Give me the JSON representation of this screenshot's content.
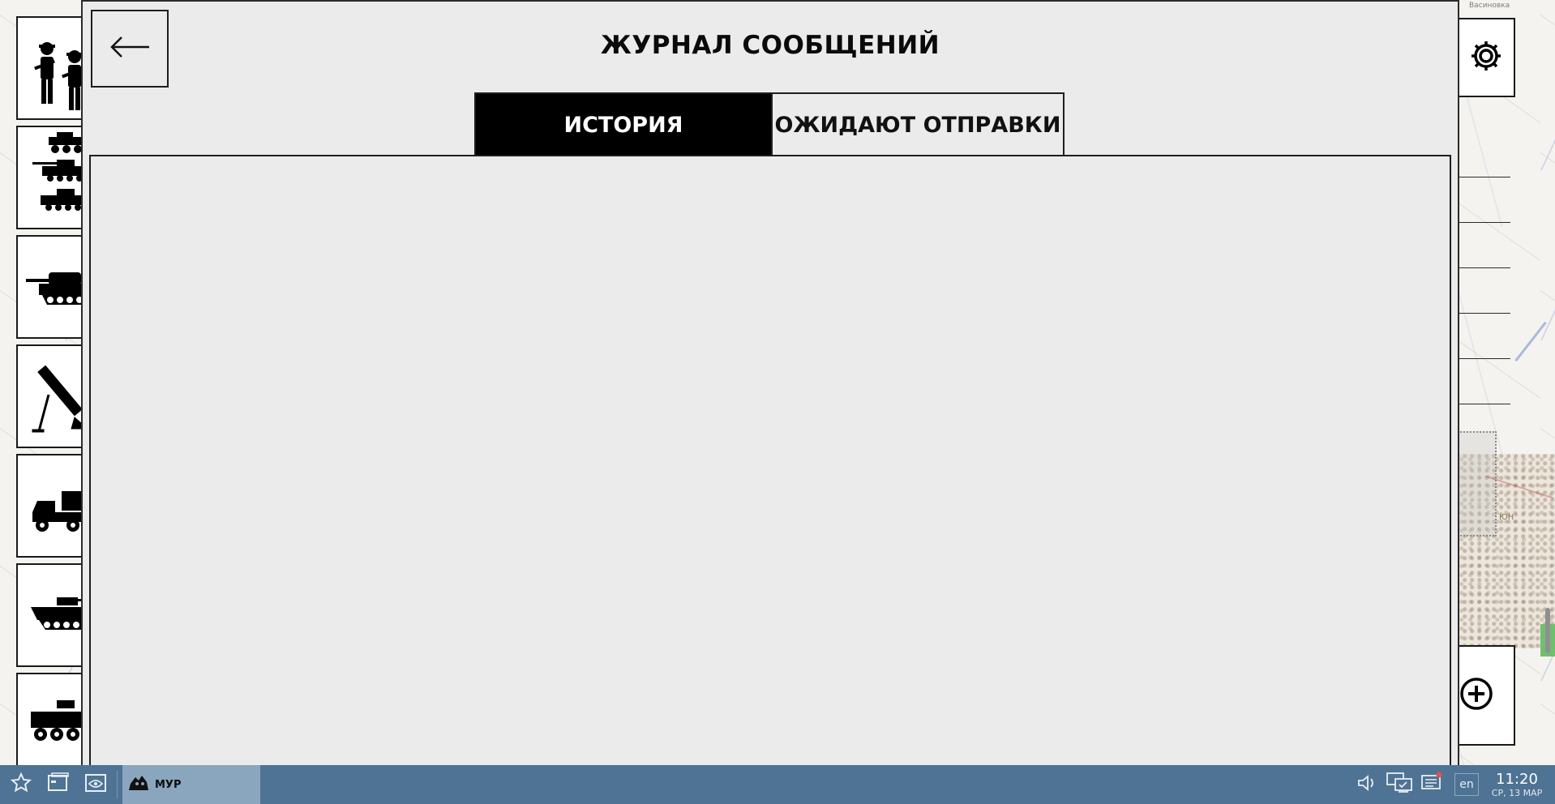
{
  "dialog": {
    "title": "ЖУРНАЛ СООБЩЕНИЙ",
    "tabs": [
      {
        "label": "ИСТОРИЯ",
        "active": true
      },
      {
        "label": "ОЖИДАЮТ ОТПРАВКИ",
        "active": false
      }
    ],
    "messages": []
  },
  "unit_panel": {
    "items": [
      {
        "icon": "infantry-icon"
      },
      {
        "icon": "armored-vehicles-icon"
      },
      {
        "icon": "tank-icon"
      },
      {
        "icon": "mortar-icon"
      },
      {
        "icon": "rocket-truck-icon"
      },
      {
        "icon": "ifv-icon"
      },
      {
        "icon": "apc-icon"
      }
    ]
  },
  "map": {
    "label_top": "Васиновка",
    "label_on": "ЮН"
  },
  "taskbar": {
    "task_label": "МУР",
    "lang": "en",
    "time": "11:20",
    "date": "СР, 13 МАР"
  },
  "colors": {
    "taskbar": "#4e7394",
    "active_task": "#8aa6bf",
    "dialog_bg": "#ebebeb",
    "tab_active_bg": "#000000",
    "tab_active_fg": "#ffffff"
  }
}
